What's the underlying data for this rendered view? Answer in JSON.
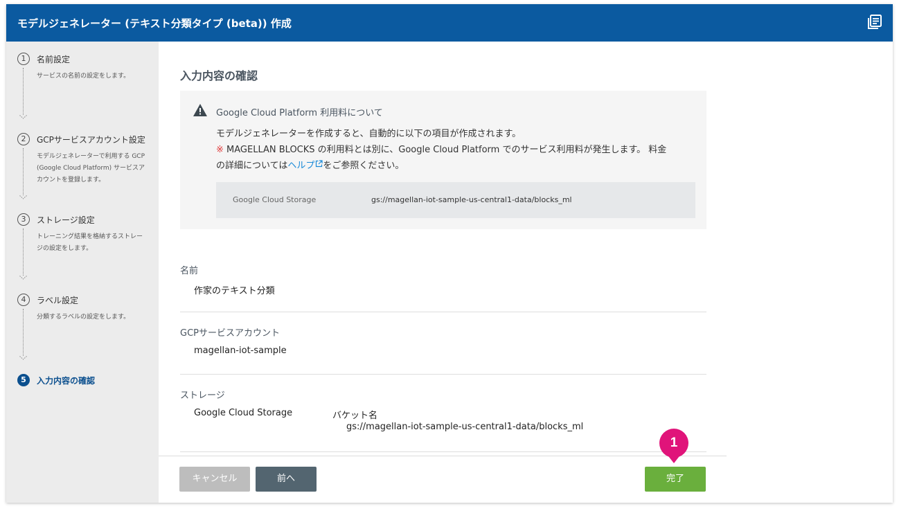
{
  "window": {
    "title": "モデルジェネレーター (テキスト分類タイプ (beta)) 作成",
    "doc_icon": "document-list-icon"
  },
  "sidebar": {
    "steps": [
      {
        "number": "1",
        "label": "名前設定",
        "desc": "サービスの名前の設定をします。",
        "active": false
      },
      {
        "number": "2",
        "label": "GCPサービスアカウント設定",
        "desc": "モデルジェネレーターで利用する GCP (Google Cloud Platform) サービスアカウントを登録します。",
        "active": false
      },
      {
        "number": "3",
        "label": "ストレージ設定",
        "desc": "トレーニング結果を格納するストレージの設定をします。",
        "active": false
      },
      {
        "number": "4",
        "label": "ラベル設定",
        "desc": "分類するラベルの設定をします。",
        "active": false
      },
      {
        "number": "5",
        "label": "入力内容の確認",
        "desc": "",
        "active": true
      }
    ]
  },
  "main": {
    "heading": "入力内容の確認",
    "notice": {
      "icon": "warning-icon",
      "title": "Google Cloud Platform 利用料について",
      "line1": "モデルジェネレーターを作成すると、自動的に以下の項目が作成されます。",
      "line2_mark": "※",
      "line2_text": " MAGELLAN BLOCKS の利用料とは別に、Google Cloud Platform でのサービス利用料が発生します。 料金",
      "line3_pre": "の詳細については",
      "line3_link": "ヘルプ",
      "line3_post": "をご参照ください。",
      "resource_key": "Google Cloud Storage",
      "resource_value": "gs://magellan-iot-sample-us-central1-data/blocks_ml"
    },
    "fields": {
      "name": {
        "label": "名前",
        "value": "作家のテキスト分類"
      },
      "gcp_account": {
        "label": "GCPサービスアカウント",
        "value": "magellan-iot-sample"
      },
      "storage": {
        "label": "ストレージ",
        "value": "Google Cloud Storage",
        "bucket_label": "バケット名",
        "bucket_value": "gs://magellan-iot-sample-us-central1-data/blocks_ml"
      }
    }
  },
  "footer": {
    "cancel_label": "キャンセル",
    "prev_label": "前へ",
    "done_label": "完了"
  },
  "callout": {
    "number": "1",
    "color": "#e0147a"
  },
  "colors": {
    "titlebar": "#0b5aa0",
    "active_step": "#0b4f8e",
    "done_button": "#6aaf3d",
    "prev_button": "#536570",
    "cancel_button": "#bdbdbd",
    "link": "#1a8ad8",
    "warning_mark": "#e03a3a"
  }
}
